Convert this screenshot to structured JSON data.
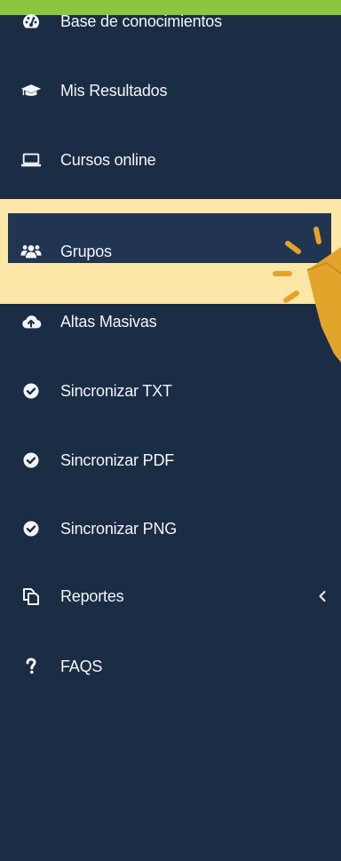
{
  "sidebar": {
    "items": [
      {
        "label": "Base de conocimientos",
        "icon": "dashboard-gauge-icon"
      },
      {
        "label": "Mis Resultados",
        "icon": "graduation-cap-icon"
      },
      {
        "label": "Cursos online",
        "icon": "laptop-icon"
      },
      {
        "label": "Grupos",
        "icon": "users-group-icon",
        "active": true
      },
      {
        "label": "Altas Masivas",
        "icon": "cloud-upload-icon"
      },
      {
        "label": "Sincronizar TXT",
        "icon": "check-circle-icon"
      },
      {
        "label": "Sincronizar PDF",
        "icon": "check-circle-icon"
      },
      {
        "label": "Sincronizar PNG",
        "icon": "check-circle-icon"
      },
      {
        "label": "Reportes",
        "icon": "copy-documents-icon",
        "has_submenu": true
      },
      {
        "label": "FAQS",
        "icon": "question-mark-icon"
      }
    ]
  },
  "colors": {
    "background": "#1b2c45",
    "top_accent": "#8cc63f",
    "highlight_frame": "#fde7a8",
    "highlight_row": "#213451",
    "pointer_accent": "#e3a42c",
    "text": "#f2f5f9"
  }
}
